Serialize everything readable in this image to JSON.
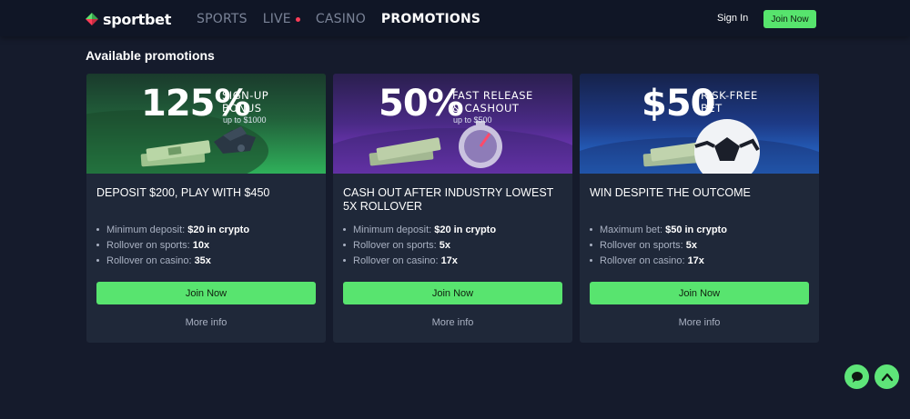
{
  "header": {
    "logo_text": "sportbet",
    "nav": [
      {
        "label": "SPORTS",
        "active": false
      },
      {
        "label": "LIVE",
        "active": false,
        "live_dot": true
      },
      {
        "label": "CASINO",
        "active": false
      },
      {
        "label": "PROMOTIONS",
        "active": true
      }
    ],
    "signin_label": "Sign In",
    "join_label": "Join Now"
  },
  "main": {
    "section_title": "Available promotions",
    "promotions": [
      {
        "banner": {
          "big": "125%",
          "line1": "SIGN-UP",
          "line2": "BONUS",
          "sub": "up to $1000",
          "theme": "green"
        },
        "title": "DEPOSIT $200, PLAY WITH $450",
        "details": [
          {
            "label": "Minimum deposit:",
            "value": "$20 in crypto"
          },
          {
            "label": "Rollover on sports:",
            "value": "10x"
          },
          {
            "label": "Rollover on casino:",
            "value": "35x"
          }
        ],
        "join_label": "Join Now",
        "more_label": "More info"
      },
      {
        "banner": {
          "big": "50%",
          "line1": "FAST RELEASE",
          "line2": "& CASHOUT",
          "sub": "up to $500",
          "theme": "purple"
        },
        "title": "CASH OUT AFTER INDUSTRY LOWEST 5X ROLLOVER",
        "details": [
          {
            "label": "Minimum deposit:",
            "value": "$20 in crypto"
          },
          {
            "label": "Rollover on sports:",
            "value": "5x"
          },
          {
            "label": "Rollover on casino:",
            "value": "17x"
          }
        ],
        "join_label": "Join Now",
        "more_label": "More info"
      },
      {
        "banner": {
          "big": "$50",
          "line1": "RISK-FREE",
          "line2": "BET",
          "sub": "",
          "theme": "blue"
        },
        "title": "WIN DESPITE THE OUTCOME",
        "details": [
          {
            "label": "Maximum bet:",
            "value": "$50 in crypto"
          },
          {
            "label": "Rollover on sports:",
            "value": "5x"
          },
          {
            "label": "Rollover on casino:",
            "value": "17x"
          }
        ],
        "join_label": "Join Now",
        "more_label": "More info"
      }
    ]
  },
  "floating": {
    "chat_icon": "chat-bubble-icon",
    "top_icon": "chevron-up-icon"
  },
  "colors": {
    "background": "#151b2c",
    "card": "#1f2839",
    "accent_green": "#58e46f",
    "live_red": "#ff3d58"
  }
}
